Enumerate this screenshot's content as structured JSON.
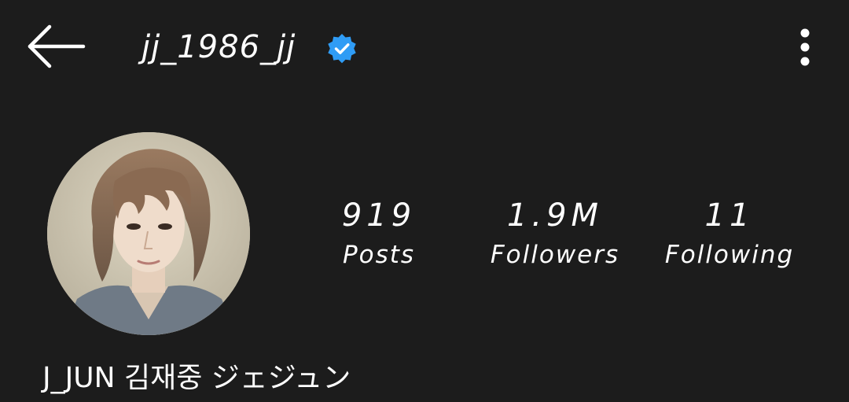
{
  "header": {
    "username": "jj_1986_jj",
    "verified": true
  },
  "profile": {
    "display_name": "J_JUN 김재중 ジェジュン"
  },
  "stats": [
    {
      "value": "919",
      "label": "Posts"
    },
    {
      "value": "1.9M",
      "label": "Followers"
    },
    {
      "value": "11",
      "label": "Following"
    }
  ],
  "colors": {
    "background": "#1c1c1c",
    "text": "#ffffff",
    "verified_badge": "#2f9cf5"
  },
  "icons": {
    "back": "arrow-left-icon",
    "verified": "verified-badge-icon",
    "more": "more-vertical-icon"
  }
}
